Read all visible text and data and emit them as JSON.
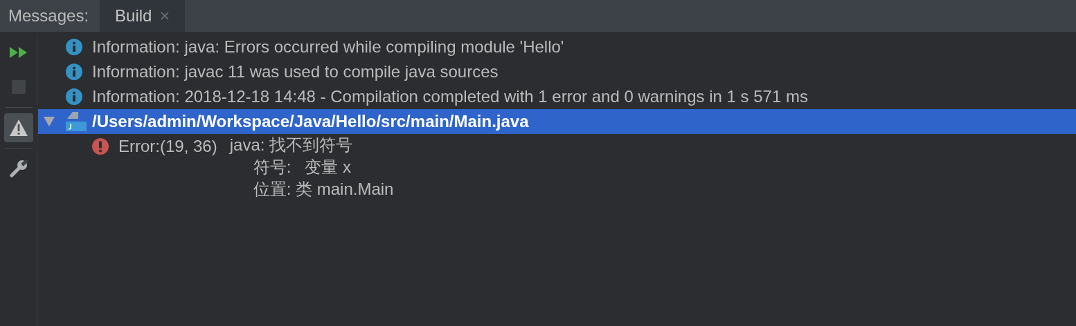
{
  "header": {
    "label": "Messages:",
    "tabs": [
      {
        "label": "Build",
        "selected": true
      }
    ]
  },
  "toolbar": [
    {
      "kind": "rerun",
      "disabled": false,
      "selected": false
    },
    {
      "kind": "stop",
      "disabled": true,
      "selected": false
    },
    {
      "kind": "warnings",
      "disabled": false,
      "selected": true
    },
    {
      "kind": "settings",
      "disabled": false,
      "selected": false
    }
  ],
  "messages": [
    {
      "kind": "info",
      "text": "Information: java: Errors occurred while compiling module 'Hello'",
      "selected": false
    },
    {
      "kind": "info",
      "text": "Information: javac 11 was used to compile java sources",
      "selected": false
    },
    {
      "kind": "info",
      "text": "Information: 2018-12-18 14:48 - Compilation completed with 1 error and 0 warnings in 1 s 571 ms",
      "selected": false
    },
    {
      "kind": "file",
      "text": "/Users/admin/Workspace/Java/Hello/src/main/Main.java",
      "selected": true,
      "expanded": true,
      "children": [
        {
          "kind": "error",
          "location": "Error:(19, 36)",
          "lines": [
            "java: 找不到符号",
            "符号:   变量 x",
            "位置: 类 main.Main"
          ],
          "selected": false
        }
      ]
    }
  ]
}
